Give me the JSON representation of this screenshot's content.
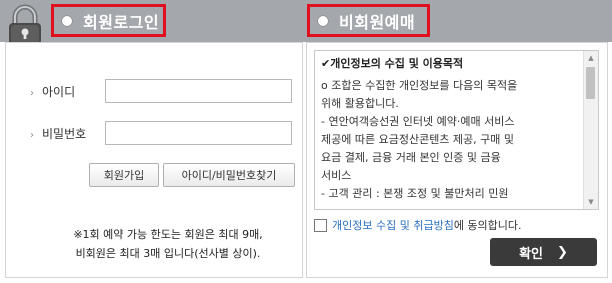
{
  "tabs": {
    "member_label": "회원로그인",
    "guest_label": "비회원예매"
  },
  "login": {
    "id_label": "아이디",
    "password_label": "비밀번호",
    "id_value": "",
    "password_value": "",
    "signup_button": "회원가입",
    "find_button": "아이디/비밀번호찾기",
    "notice_line1": "※1회 예약 가능 한도는 회원은 최대 9매,",
    "notice_line2": "비회원은 최대 3매 입니다(선사별 상이)."
  },
  "privacy": {
    "title": "✔개인정보의 수집 및 이용목적",
    "lines": [
      "o 조합은 수집한 개인정보를 다음의 목적을",
      "위해 활용합니다.",
      "- 연안여객승선권 인터넷 예약·예매 서비스",
      "제공에 따른 요금정산콘텐츠 제공, 구매 및",
      "요금 결제, 금융 거래 본인 인증 및 금융",
      "서비스",
      "- 고객 관리 : 본쟁 조정 및 불만처리 민원"
    ],
    "agree_link": "개인정보 수집 및 취급방침",
    "agree_suffix": "에 동의합니다.",
    "confirm_label": "확인"
  },
  "colors": {
    "tab_bar": "#a4a7ab",
    "tab_highlight": "#e01020",
    "confirm_bg": "#3a3a3a",
    "link": "#2a6fbf"
  },
  "icons": {
    "lock": "padlock-icon",
    "confirm": "chevron-right-icon"
  }
}
